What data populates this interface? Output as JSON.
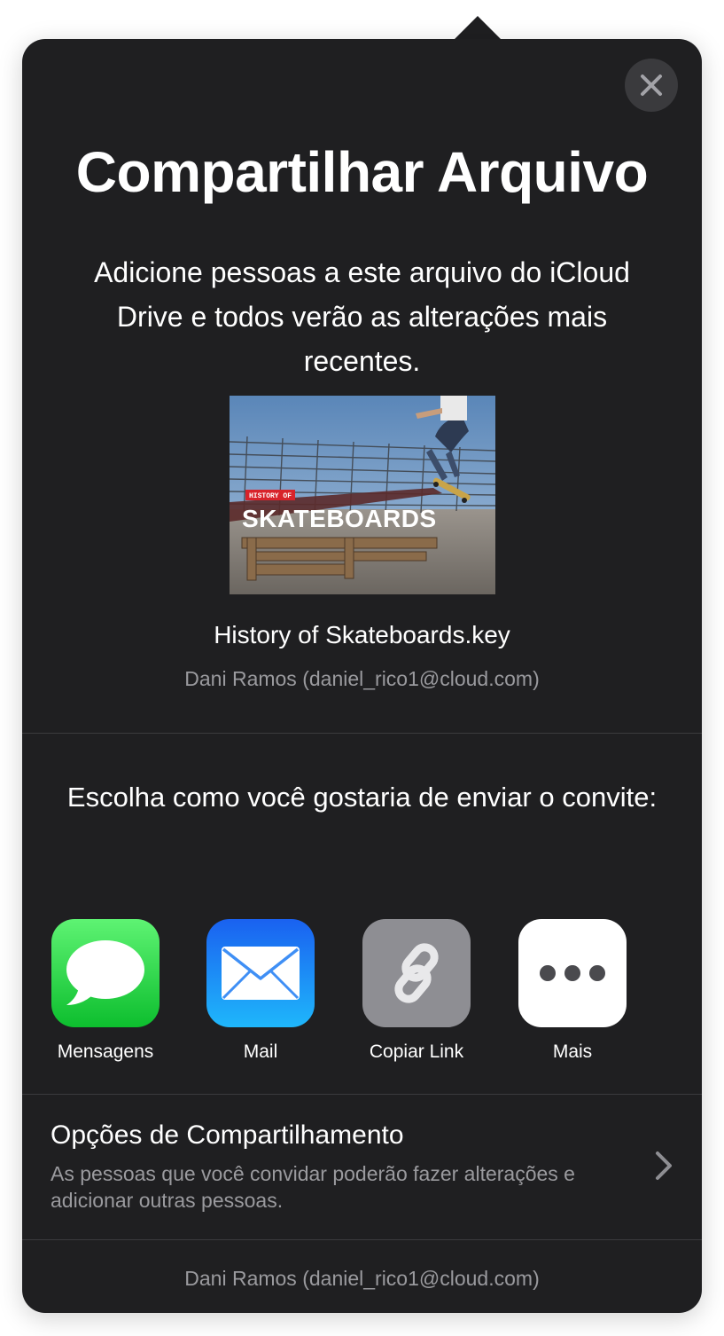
{
  "dialog": {
    "title": "Compartilhar Arquivo",
    "description": "Adicione pessoas a este arquivo do iCloud Drive e todos verão as alterações mais recentes.",
    "close_icon": "close-icon"
  },
  "file": {
    "thumbnail_small_text": "HISTORY OF",
    "thumbnail_big_text": "SKATEBOARDS",
    "name": "History of Skateboards.key",
    "owner": "Dani Ramos (daniel_rico1@cloud.com)"
  },
  "invite": {
    "prompt": "Escolha como você gostaria de enviar o convite:",
    "methods": [
      {
        "label": "Mensagens",
        "icon": "messages-icon",
        "color": "#34c759"
      },
      {
        "label": "Mail",
        "icon": "mail-icon",
        "color": "#1e7cf2"
      },
      {
        "label": "Copiar Link",
        "icon": "link-icon",
        "color": "#8e8e93"
      },
      {
        "label": "Mais",
        "icon": "more-icon",
        "color": "#ffffff"
      }
    ]
  },
  "options": {
    "title": "Opções de Compartilhamento",
    "subtitle": "As pessoas que você convidar poderão fazer alterações e adicionar outras pessoas.",
    "chevron_icon": "chevron-right-icon"
  },
  "footer": {
    "owner": "Dani Ramos (daniel_rico1@cloud.com)"
  },
  "colors": {
    "sheet_background": "#1f1f21",
    "divider": "#3b3b3e",
    "secondary_text": "#9a9a9e"
  }
}
